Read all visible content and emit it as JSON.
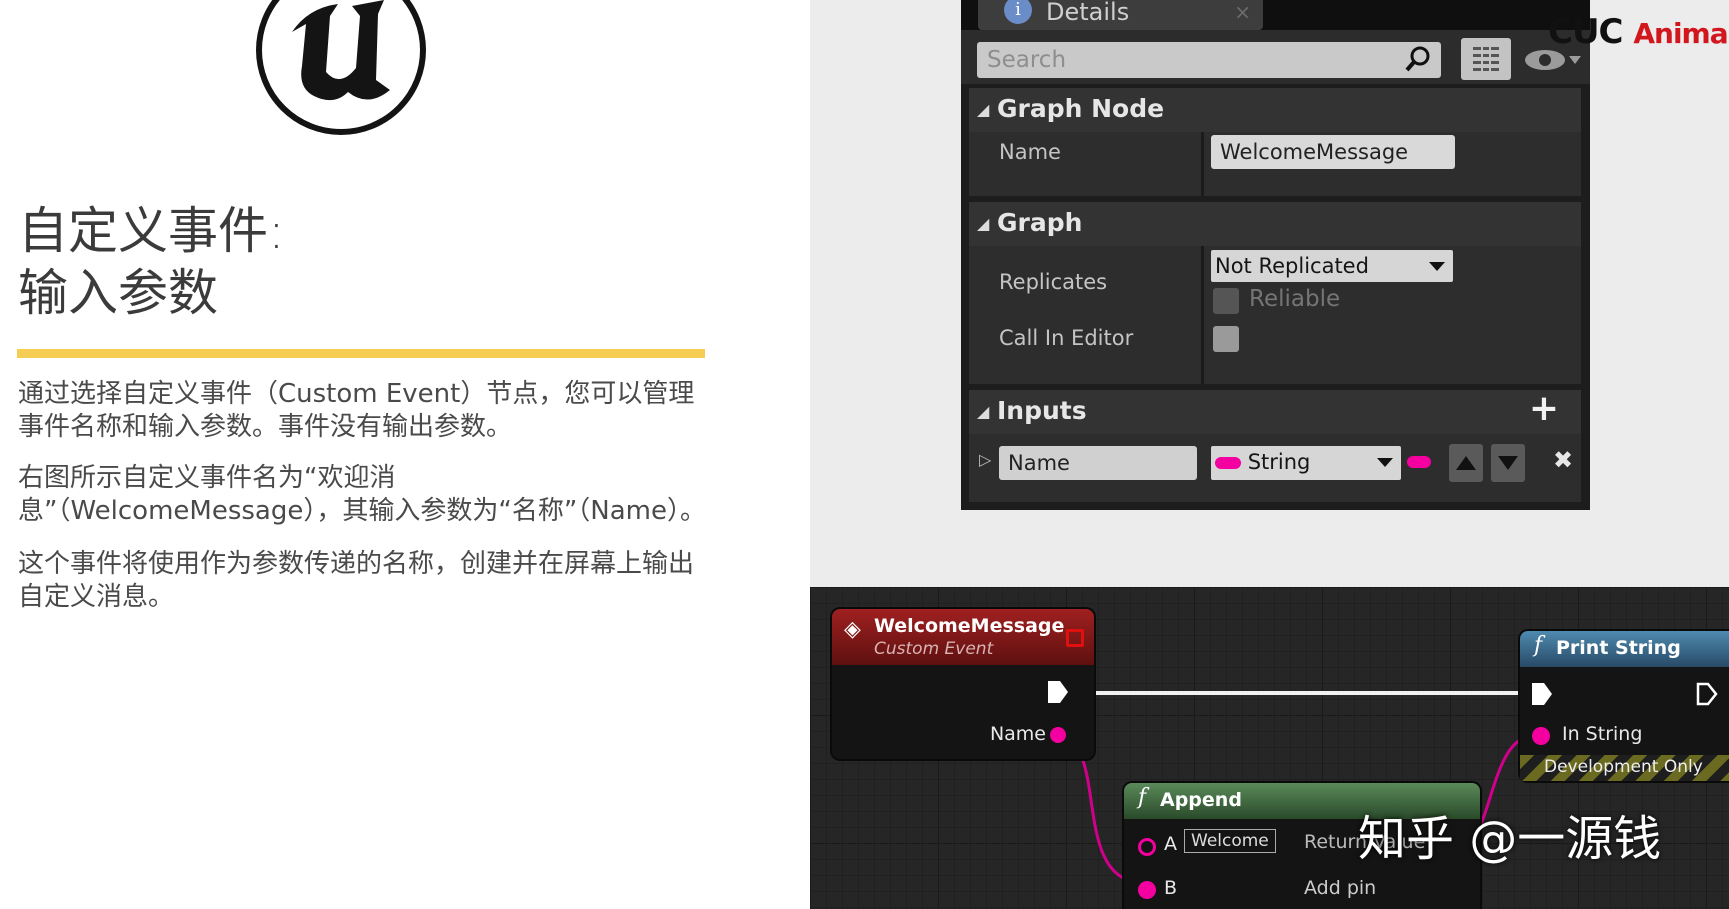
{
  "slide": {
    "title_line1": "自定义事件:",
    "title_line2": "输入参数",
    "paragraphs": [
      "通过选择自定义事件（Custom Event）节点，您可以管理事件名称和输入参数。事件没有输出参数。",
      "右图所示自定义事件名为“欢迎消息”（WelcomeMessage），其输入参数为“名称”（Name）。",
      "这个事件将使用作为参数传递的名称，创建并在屏幕上输出自定义消息。"
    ],
    "accent_color": "#f5cd52"
  },
  "details_panel": {
    "tab_label": "Details",
    "tab_close": "×",
    "tab_icon": "info-icon",
    "search_placeholder": "Search",
    "sections": {
      "graph_node": {
        "title": "Graph Node",
        "name_label": "Name",
        "name_value": "WelcomeMessage"
      },
      "graph": {
        "title": "Graph",
        "replicates_label": "Replicates",
        "replicates_value": "Not Replicated",
        "reliable_label": "Reliable",
        "call_in_editor_label": "Call In Editor"
      },
      "inputs": {
        "title": "Inputs",
        "add_label": "+",
        "param_name": "Name",
        "param_type": "String",
        "remove_label": "✖"
      }
    }
  },
  "graph": {
    "event_node": {
      "title": "WelcomeMessage",
      "subtitle": "Custom Event",
      "pin_name": "Name"
    },
    "append_node": {
      "title": "Append",
      "pin_a": "A",
      "pin_a_value": "Welcome",
      "pin_b": "B",
      "return_label": "Return Value",
      "add_pin": "Add pin"
    },
    "print_node": {
      "title": "Print String",
      "pin_in_string": "In String",
      "dev_only": "Development Only"
    },
    "colors": {
      "string_pin": "#f400a1",
      "event_head": "#8e1a1a",
      "function_head": "#3d6a8a"
    }
  },
  "overlays": {
    "watermark": "知乎 @一源钱",
    "brand_cuc": "CUC",
    "brand_anim": "Anima"
  }
}
